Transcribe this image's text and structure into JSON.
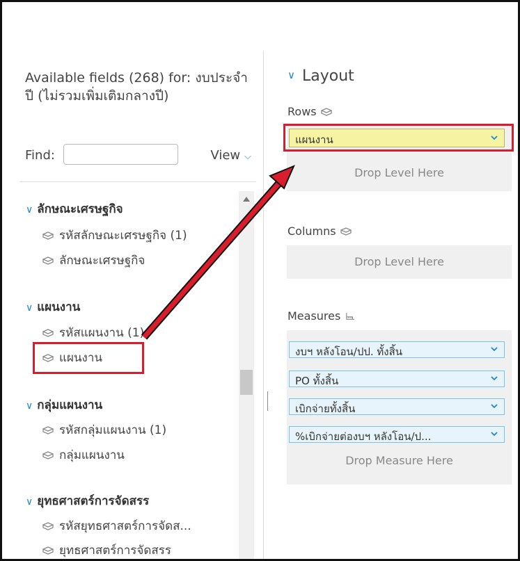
{
  "colors": {
    "accent": "#1e86d6",
    "highlight_red": "#d81e2c",
    "rows_pill_bg": "#f6f3a3"
  },
  "left_panel": {
    "available_fields_text": "Available fields (268) for: งบประจำปี (ไม่รวมเพิ่มเติมกลางปี)",
    "find_label": "Find:",
    "find_value": "",
    "view_label": "View",
    "groups": [
      {
        "label": "ลักษณะเศรษฐกิจ",
        "fields": [
          "รหัสลักษณะเศรษฐกิจ (1)",
          "ลักษณะเศรษฐกิจ"
        ]
      },
      {
        "label": "แผนงาน",
        "fields": [
          "รหัสแผนงาน (1)",
          "แผนงาน"
        ]
      },
      {
        "label": "กลุ่มแผนงาน",
        "fields": [
          "รหัสกลุ่มแผนงาน (1)",
          "กลุ่มแผนงาน"
        ]
      },
      {
        "label": "ยุทธศาสตร์การจัดสรร",
        "fields": [
          "รหัสยุทธศาสตร์การจัดส...",
          "ยุทธศาสตร์การจัดสรร"
        ]
      }
    ]
  },
  "layout": {
    "title": "Layout",
    "rows_label": "Rows",
    "rows_field": "แผนงาน",
    "rows_drop": "Drop Level Here",
    "columns_label": "Columns",
    "columns_drop": "Drop Level Here",
    "measures_label": "Measures",
    "measures": [
      "งบฯ หลังโอน/ปป. ทั้งสิ้น",
      "PO ทั้งสิ้น",
      "เบิกจ่ายทั้งสิ้น",
      "%เบิกจ่ายต่องบฯ หลังโอน/ป..."
    ],
    "measures_drop": "Drop Measure Here"
  }
}
